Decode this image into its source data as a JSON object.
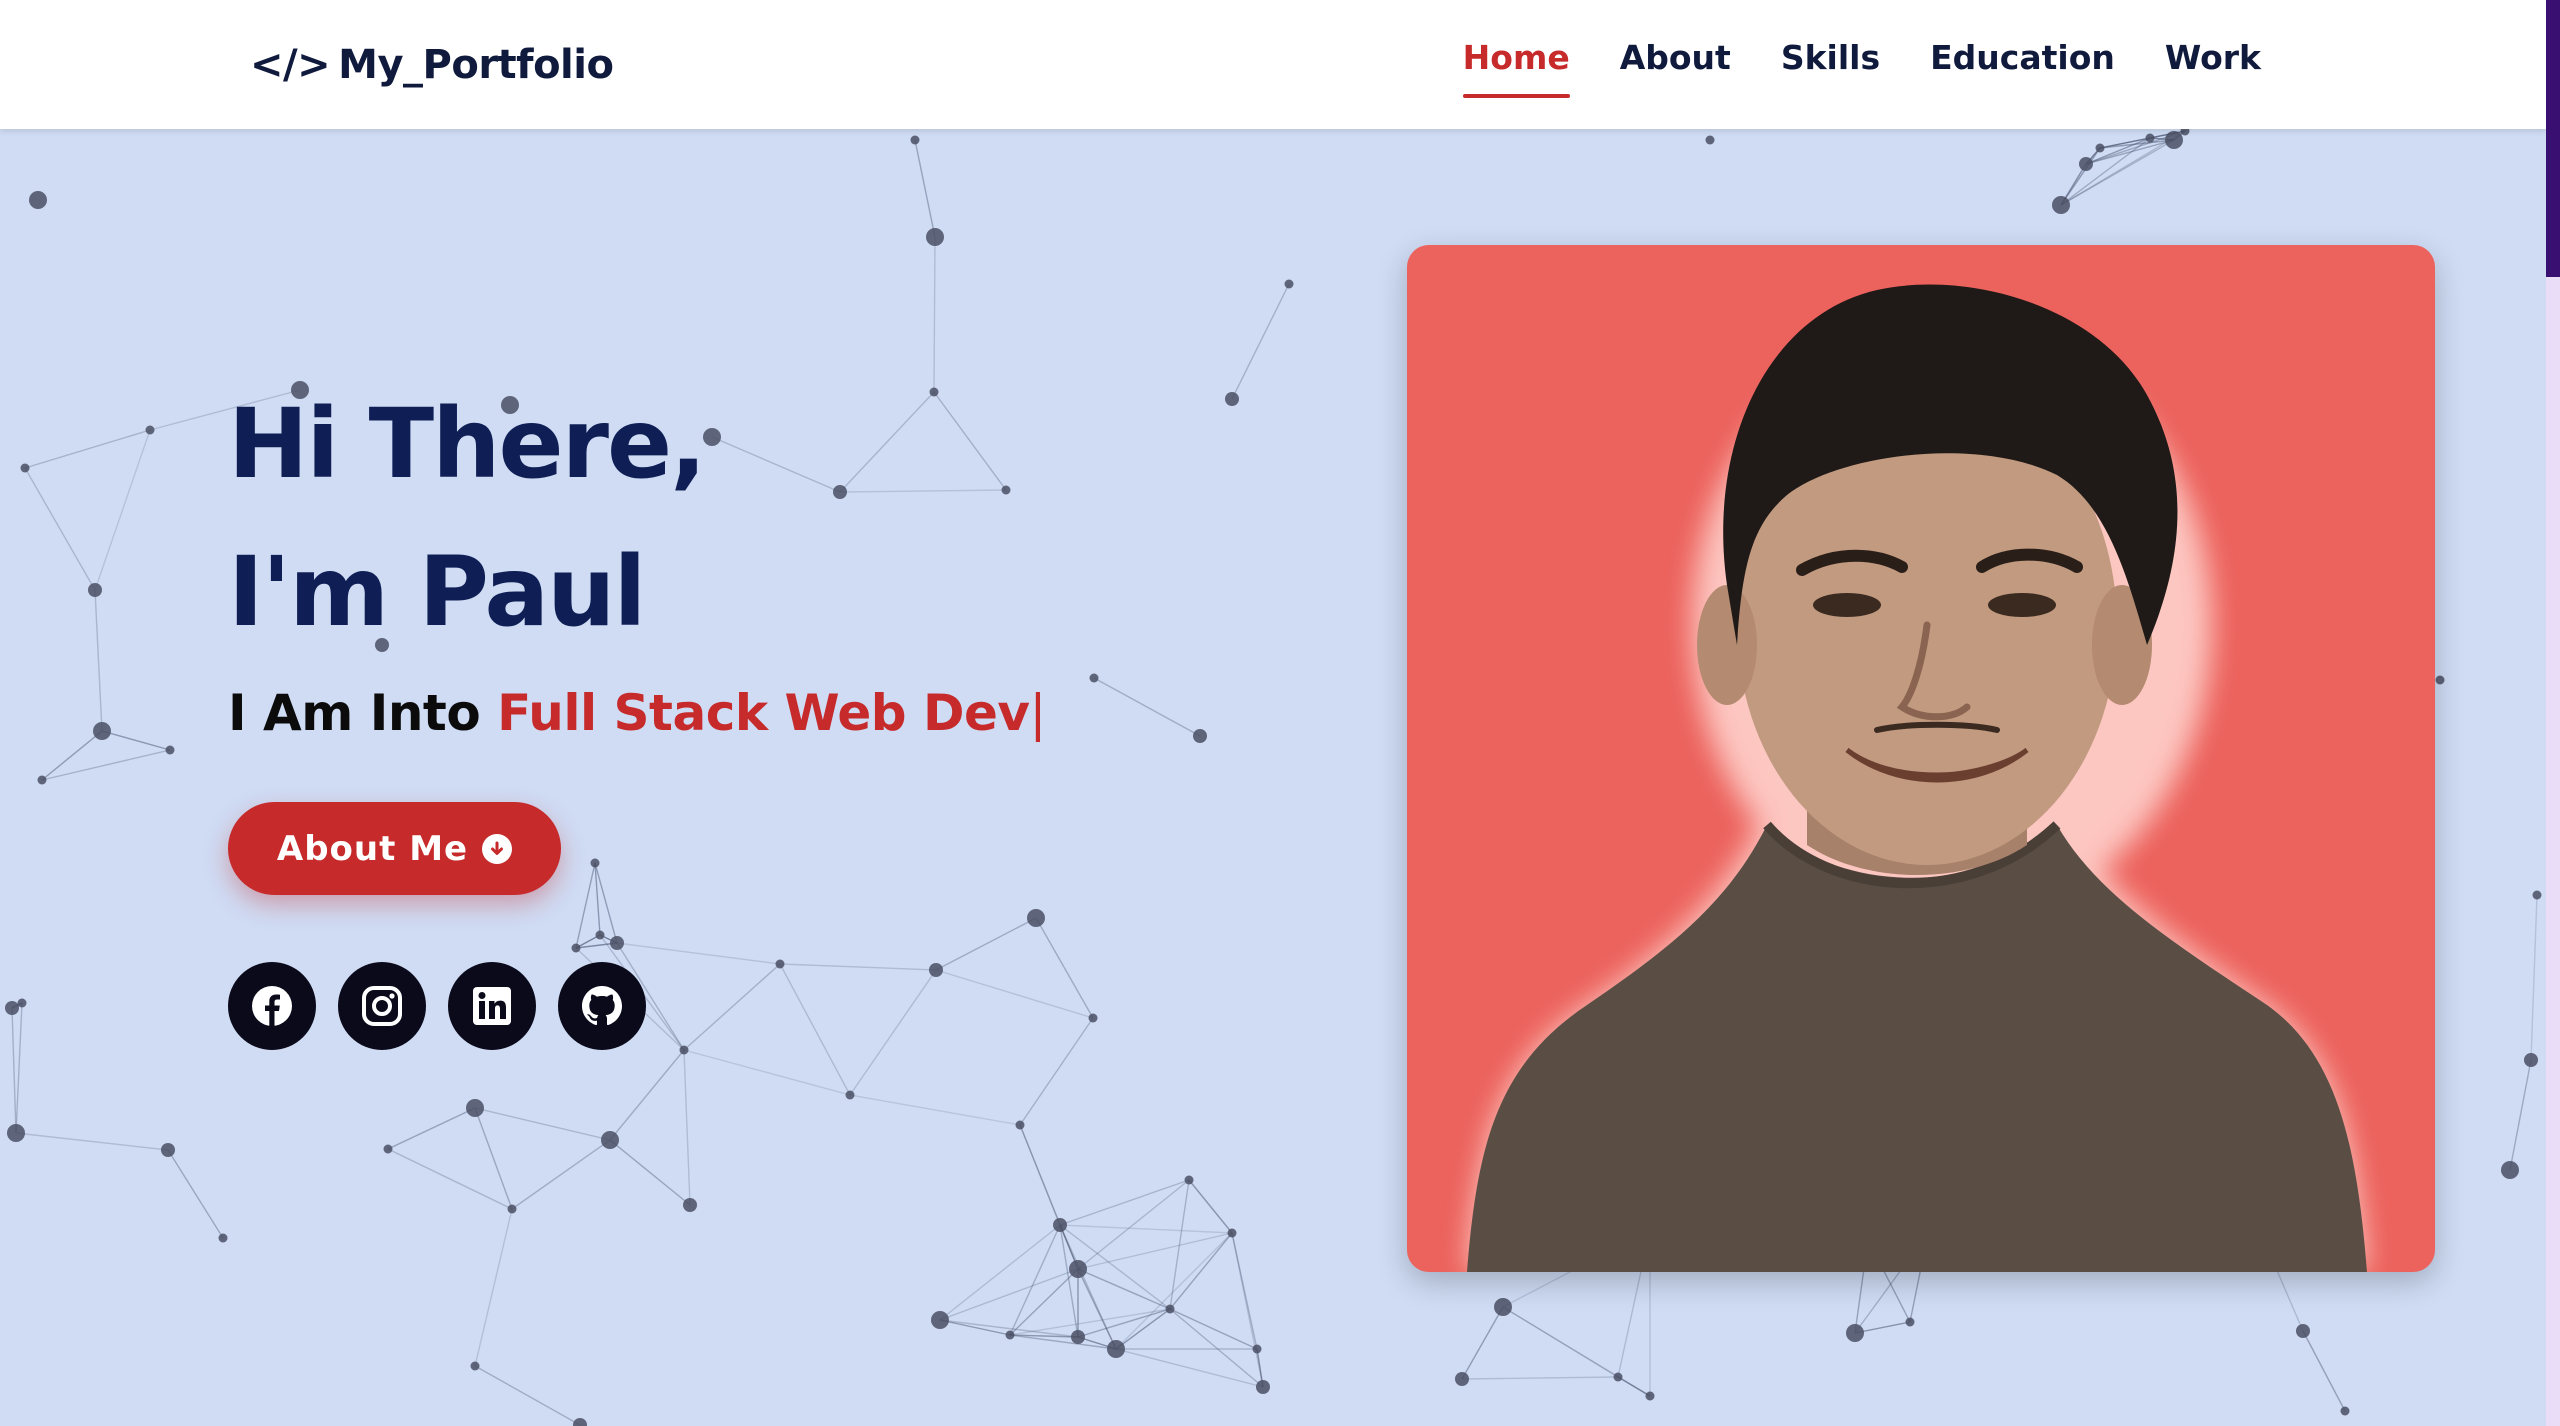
{
  "header": {
    "logo_icon": "</>",
    "logo_text": "My_Portfolio",
    "nav": [
      {
        "label": "Home",
        "active": true
      },
      {
        "label": "About",
        "active": false
      },
      {
        "label": "Skills",
        "active": false
      },
      {
        "label": "Education",
        "active": false
      },
      {
        "label": "Work",
        "active": false
      }
    ]
  },
  "hero": {
    "greeting_line1": "Hi There,",
    "greeting_line2": "I'm Paul",
    "typing_prefix": "I Am Into",
    "typing_text": "Full Stack Web Dev",
    "typing_cursor": "|",
    "button_label": "About Me",
    "button_icon": "arrow-down-circle-icon",
    "socials": [
      {
        "name": "facebook-icon"
      },
      {
        "name": "instagram-icon"
      },
      {
        "name": "linkedin-icon"
      },
      {
        "name": "github-icon"
      }
    ]
  },
  "colors": {
    "background": "#cfdcf4",
    "accent": "#c62a2a",
    "heading": "#0f1f55",
    "photo_background": "#ec625d",
    "social_bg": "#0a0a1a",
    "scroll_thumb": "#3a0f72"
  }
}
